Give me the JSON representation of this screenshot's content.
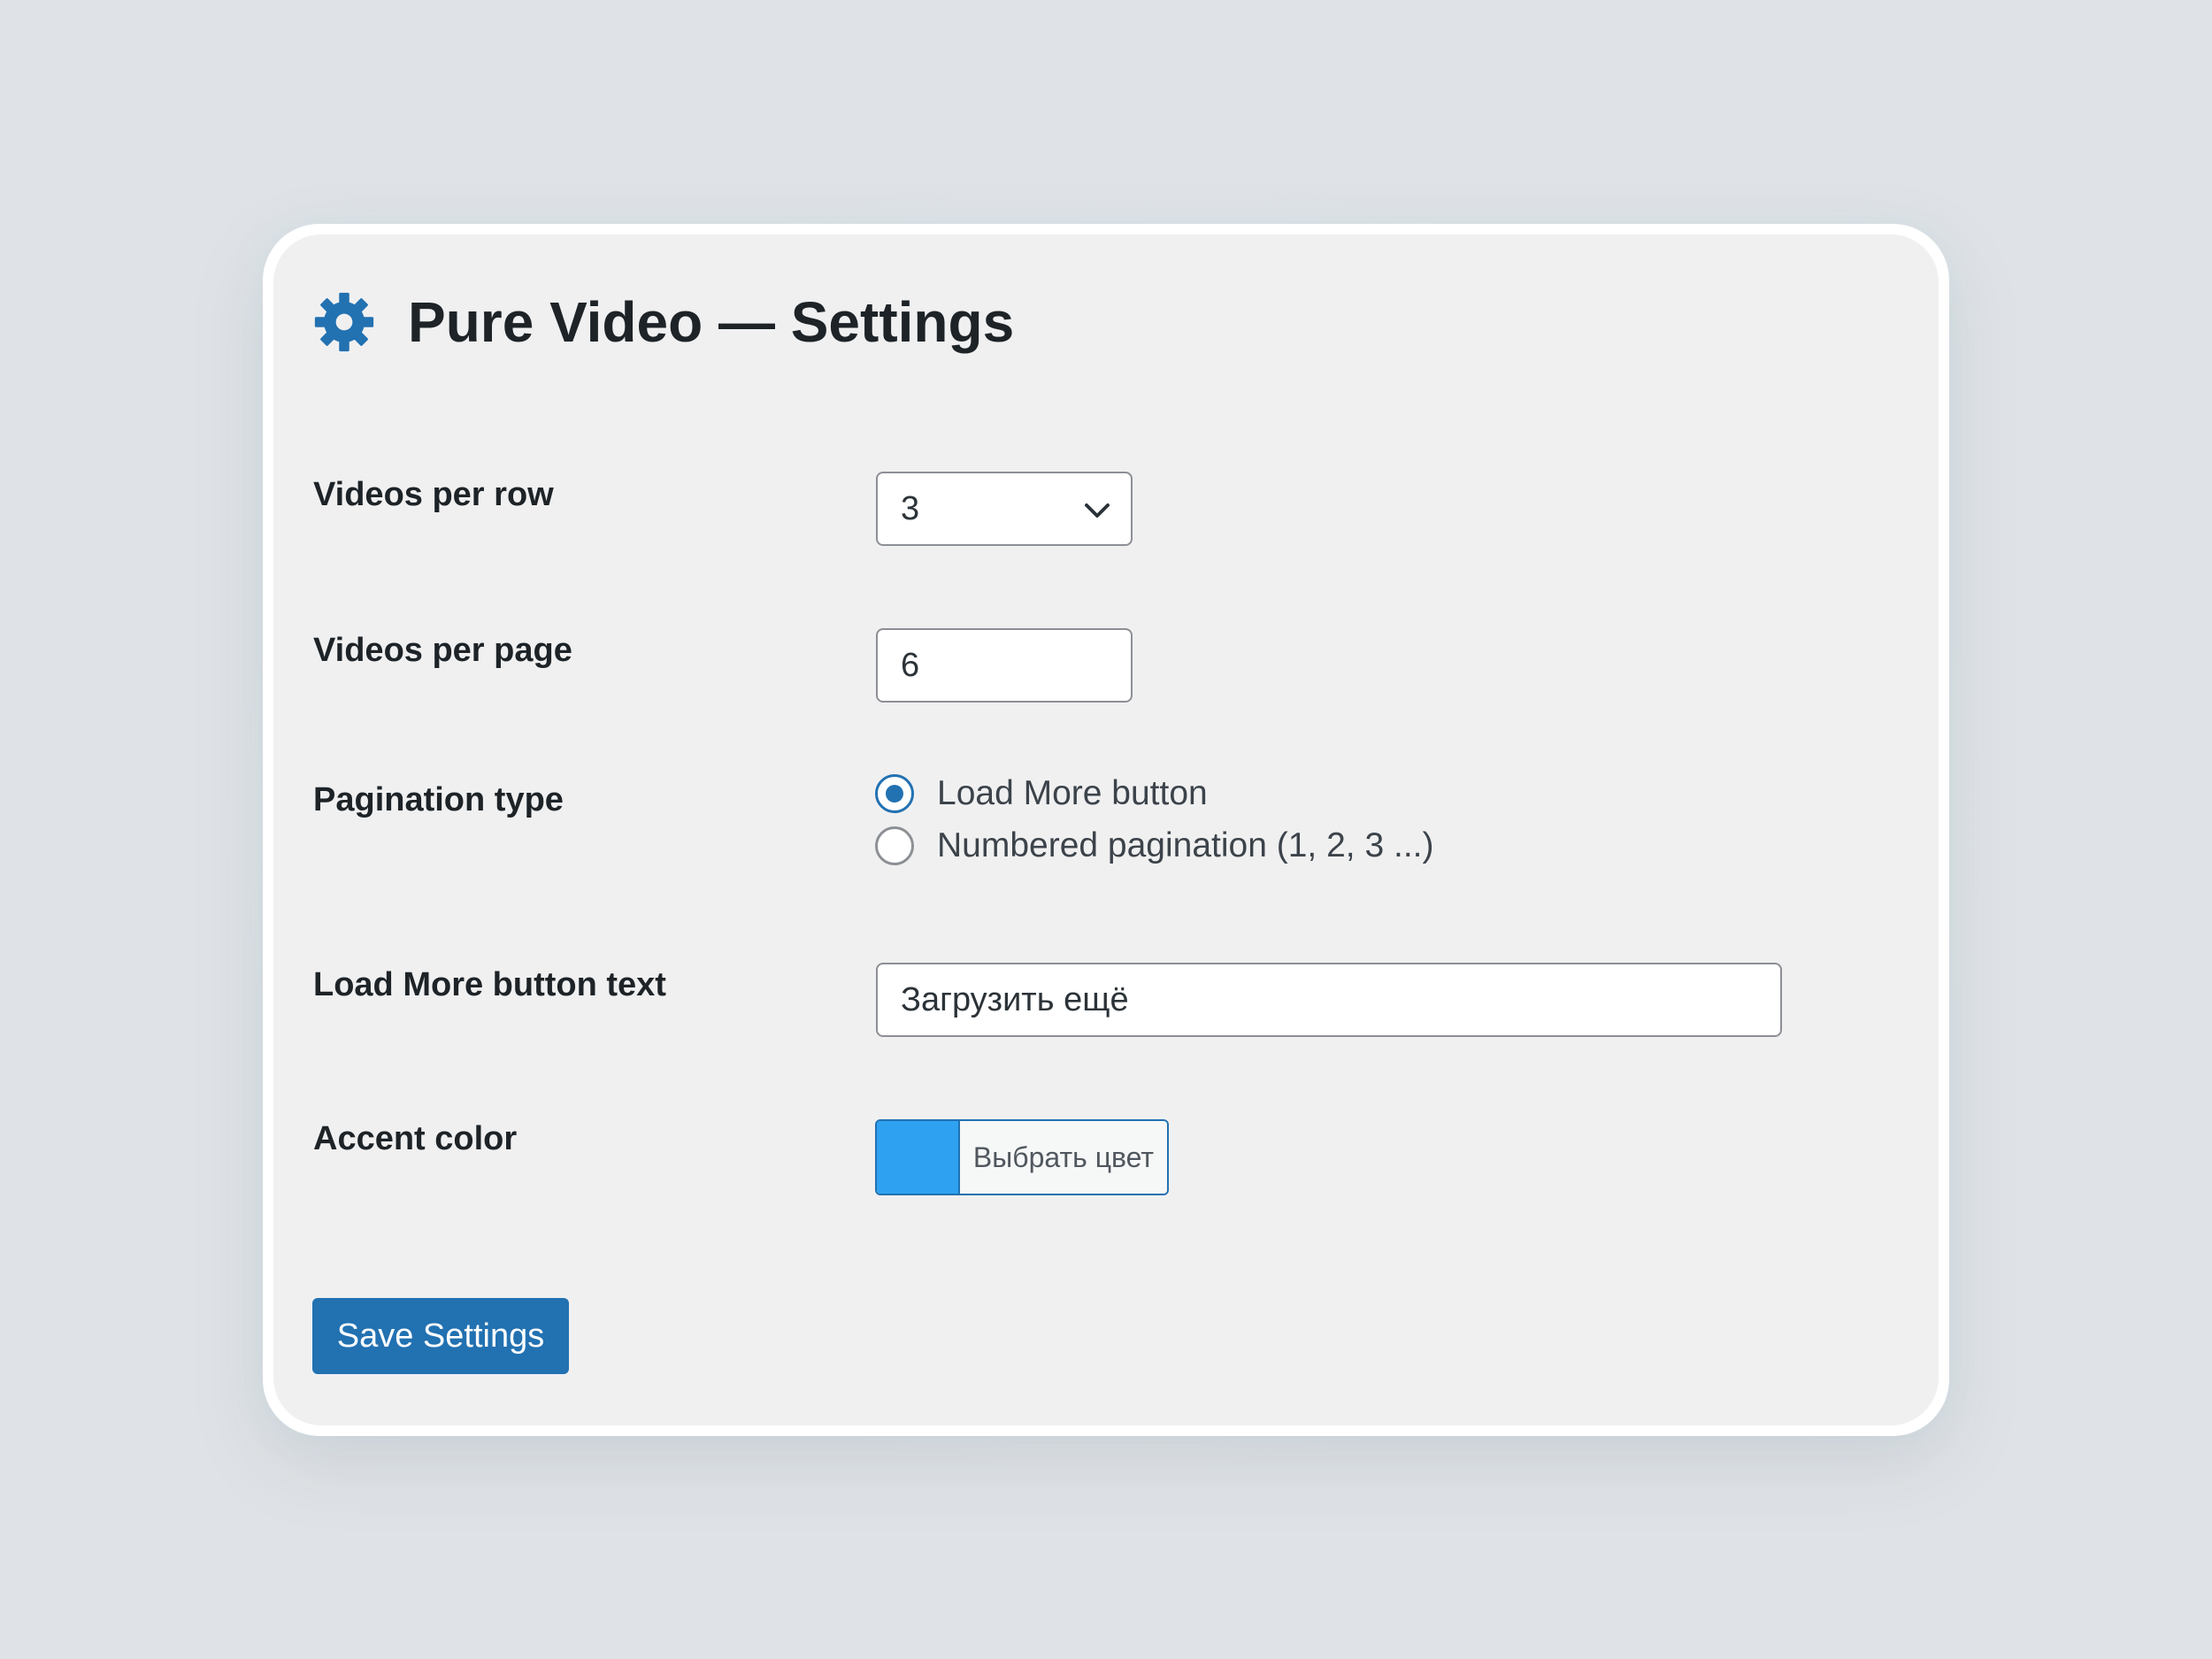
{
  "header": {
    "title": "Pure Video — Settings",
    "icon": "gear-icon"
  },
  "fields": {
    "videos_per_row": {
      "label": "Videos per row",
      "value": "3"
    },
    "videos_per_page": {
      "label": "Videos per page",
      "value": "6"
    },
    "pagination_type": {
      "label": "Pagination type",
      "options": [
        {
          "label": "Load More button",
          "checked": true
        },
        {
          "label": "Numbered pagination (1, 2, 3 ...)",
          "checked": false
        }
      ]
    },
    "load_more_text": {
      "label": "Load More button text",
      "value": "Загрузить ещё"
    },
    "accent_color": {
      "label": "Accent color",
      "button_label": "Выбрать цвет",
      "color": "#2ea2f0"
    }
  },
  "actions": {
    "save_label": "Save Settings"
  },
  "colors": {
    "primary": "#2271b1",
    "background": "#dfe3e7",
    "card": "#f0f0f1"
  }
}
